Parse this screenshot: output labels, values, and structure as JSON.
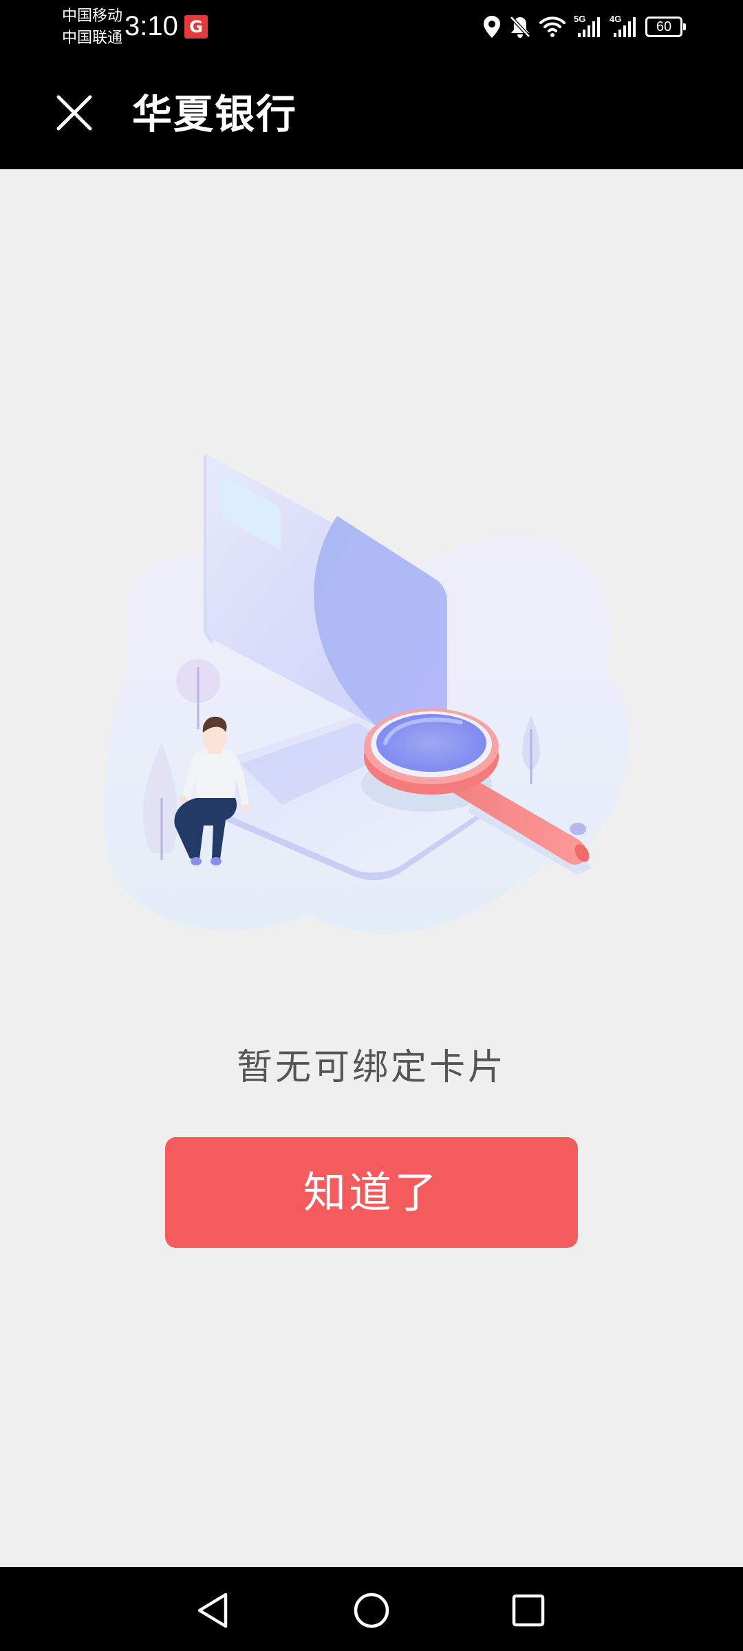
{
  "status_bar": {
    "carrier_1": "中国移动",
    "carrier_2": "中国联通",
    "time": "3:10",
    "app_badge_glyph": "G",
    "network_1": "5G",
    "network_2": "4G",
    "battery_level": "60",
    "icons": [
      "location-icon",
      "bell-muted-icon",
      "wifi-icon",
      "signal-5g-icon",
      "signal-4g-icon",
      "battery-icon"
    ]
  },
  "header": {
    "close_icon": "close-icon",
    "title": "华夏银行"
  },
  "main": {
    "illustration": "card-search-empty-illustration",
    "empty_message": "暂无可绑定卡片",
    "confirm_label": "知道了"
  },
  "nav_bar": {
    "icons": [
      "back-icon",
      "home-icon",
      "recents-icon"
    ]
  },
  "colors": {
    "status_bar_bg": "#000000",
    "page_bg": "#efefef",
    "button_bg": "#f45b5d",
    "button_text": "#ffffff",
    "message_text": "#555555"
  }
}
